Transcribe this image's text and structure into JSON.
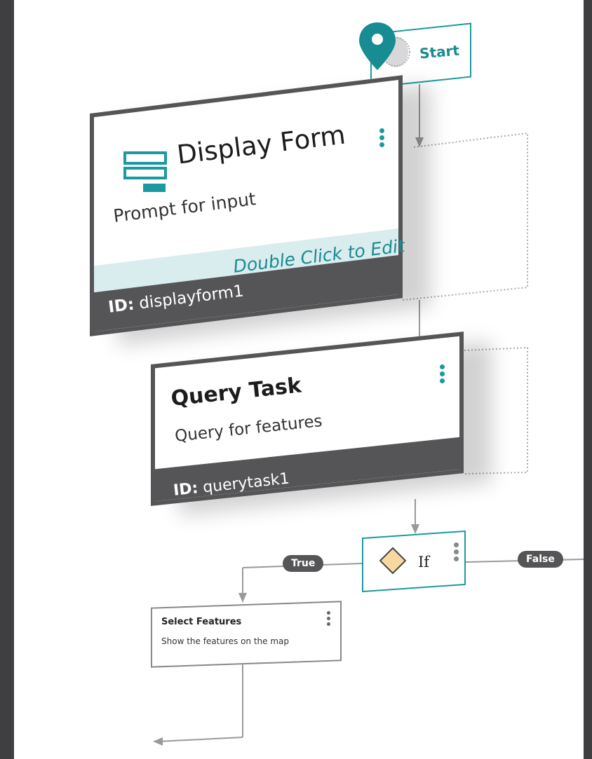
{
  "start": {
    "label": "Start"
  },
  "display_form": {
    "title": "Display Form",
    "subtitle": "Prompt for input",
    "edit_hint": "Double Click to Edit",
    "id_label": "ID:",
    "id_value": "displayform1",
    "menu_icon": "vertical-ellipsis-icon",
    "icon": "form-icon"
  },
  "query_task": {
    "title": "Query Task",
    "subtitle": "Query for features",
    "id_label": "ID:",
    "id_value": "querytask1",
    "menu_icon": "vertical-ellipsis-icon"
  },
  "if_node": {
    "label": "If",
    "icon": "diamond-icon",
    "menu_icon": "vertical-ellipsis-icon"
  },
  "branches": {
    "true_label": "True",
    "false_label": "False"
  },
  "select_features": {
    "title": "Select Features",
    "subtitle": "Show the features on the map",
    "menu_icon": "vertical-ellipsis-icon"
  },
  "colors": {
    "accent": "#1a9aa0",
    "card_footer": "#555558",
    "edit_band": "#d9ecee",
    "diamond_fill": "#f7d9a0",
    "background": "#3f3f42"
  }
}
